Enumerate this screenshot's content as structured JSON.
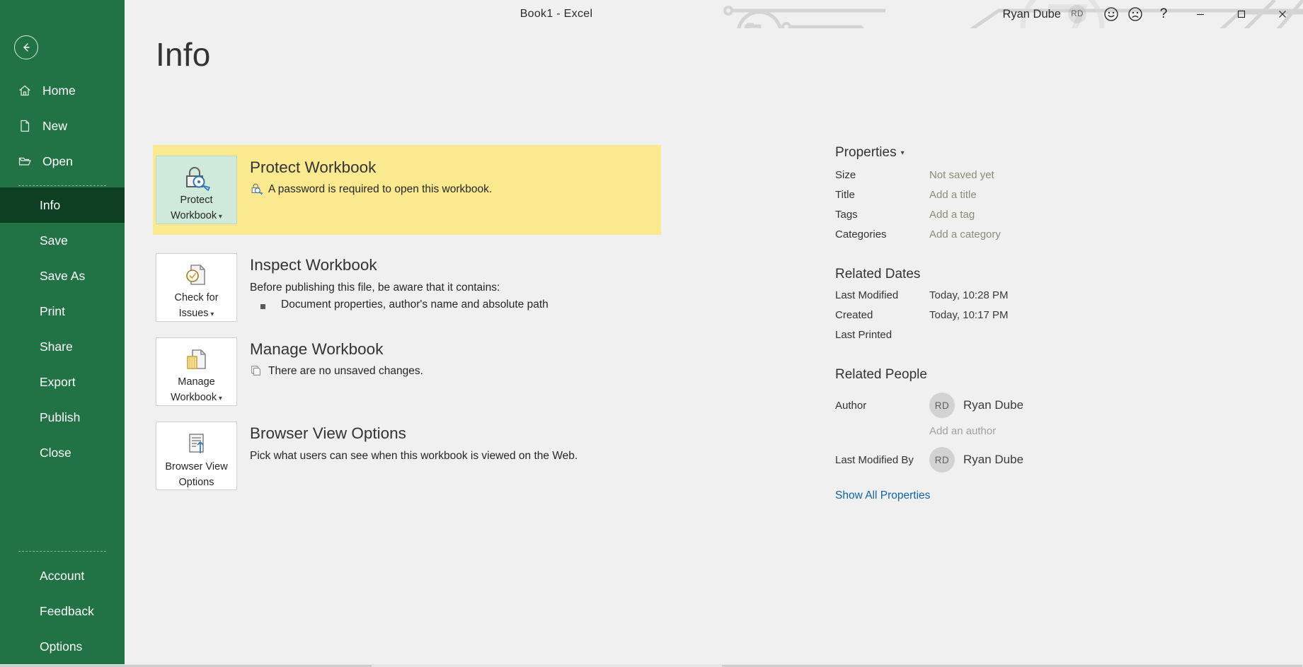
{
  "window": {
    "doc_title": "Book1  -  Excel",
    "user_name": "Ryan Dube",
    "user_initials": "RD",
    "help_glyph": "?",
    "minimize_label": "Minimize",
    "maximize_label": "Restore Down",
    "close_label": "Close",
    "smile_icon": "smiley-face-icon",
    "frown_icon": "frowny-face-icon"
  },
  "sidebar": {
    "back_label": "Back",
    "top_items": [
      {
        "label": "Home",
        "icon": "home-icon"
      },
      {
        "label": "New",
        "icon": "new-document-icon"
      },
      {
        "label": "Open",
        "icon": "open-folder-icon"
      }
    ],
    "mid_items": [
      {
        "label": "Info",
        "active": true
      },
      {
        "label": "Save",
        "active": false
      },
      {
        "label": "Save As",
        "active": false
      },
      {
        "label": "Print",
        "active": false
      },
      {
        "label": "Share",
        "active": false
      },
      {
        "label": "Export",
        "active": false
      },
      {
        "label": "Publish",
        "active": false
      },
      {
        "label": "Close",
        "active": false
      }
    ],
    "bottom_items": [
      {
        "label": "Account"
      },
      {
        "label": "Feedback"
      },
      {
        "label": "Options"
      }
    ]
  },
  "page": {
    "title": "Info"
  },
  "cards": [
    {
      "id": "protect-workbook",
      "highlighted": true,
      "button_label_line1": "Protect",
      "button_label_line2": "Workbook",
      "button_has_caret": true,
      "button_icon": "lock-key-icon",
      "heading": "Protect Workbook",
      "status_icon": "lock-key-small-icon",
      "status_text": "A password is required to open this workbook."
    },
    {
      "id": "inspect-workbook",
      "highlighted": false,
      "button_label_line1": "Check for",
      "button_label_line2": "Issues",
      "button_has_caret": true,
      "button_icon": "document-check-icon",
      "heading": "Inspect Workbook",
      "status_text": "Before publishing this file, be aware that it contains:",
      "bullets": [
        "Document properties, author's name and absolute path"
      ]
    },
    {
      "id": "manage-workbook",
      "highlighted": false,
      "button_label_line1": "Manage",
      "button_label_line2": "Workbook",
      "button_has_caret": true,
      "button_icon": "document-versions-icon",
      "heading": "Manage Workbook",
      "status_icon": "copy-pages-icon",
      "status_text": "There are no unsaved changes."
    },
    {
      "id": "browser-view-options",
      "highlighted": false,
      "button_label_line1": "Browser View",
      "button_label_line2": "Options",
      "button_has_caret": false,
      "button_icon": "browser-upload-icon",
      "heading": "Browser View Options",
      "status_text": "Pick what users can see when this workbook is viewed on the Web."
    }
  ],
  "properties": {
    "header": "Properties",
    "rows": [
      {
        "label": "Size",
        "value": "Not saved yet"
      },
      {
        "label": "Title",
        "value": "Add a title"
      },
      {
        "label": "Tags",
        "value": "Add a tag"
      },
      {
        "label": "Categories",
        "value": "Add a category"
      }
    ],
    "related_dates": {
      "header": "Related Dates",
      "rows": [
        {
          "label": "Last Modified",
          "value": "Today, 10:28 PM"
        },
        {
          "label": "Created",
          "value": "Today, 10:17 PM"
        },
        {
          "label": "Last Printed",
          "value": ""
        }
      ]
    },
    "related_people": {
      "header": "Related People",
      "author_label": "Author",
      "author_initials": "RD",
      "author_name": "Ryan Dube",
      "add_author": "Add an author",
      "modified_by_label": "Last Modified By",
      "modified_by_initials": "RD",
      "modified_by_name": "Ryan Dube"
    },
    "show_all": "Show All Properties"
  },
  "colors": {
    "brand_green": "#217346",
    "active_green": "#0d4022",
    "highlight_yellow": "#fbe98f",
    "button_green": "#cfeadb",
    "link_blue": "#1264a3",
    "page_bg": "#f0f0f0"
  }
}
